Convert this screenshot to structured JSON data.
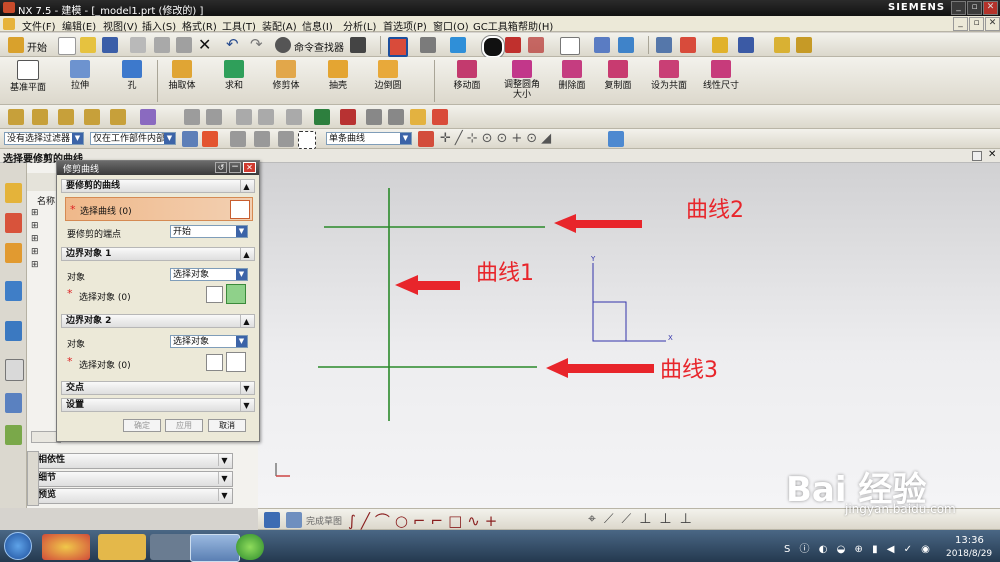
{
  "window": {
    "title": "NX 7.5 - 建模 - [_model1.prt  (修改的) ]",
    "brand": "SIEMENS"
  },
  "menus": [
    "文件(F)",
    "编辑(E)",
    "视图(V)",
    "插入(S)",
    "格式(R)",
    "工具(T)",
    "装配(A)",
    "信息(I)",
    "分析(L)",
    "首选项(P)",
    "窗口(O)",
    "GC工具箱",
    "帮助(H)"
  ],
  "toolbar1": {
    "start_label": "开始",
    "command_finder": "命令查找器"
  },
  "feature_buttons": [
    {
      "label": "基准平面"
    },
    {
      "label": "拉伸"
    },
    {
      "label": "孔"
    },
    {
      "label": "抽取体"
    },
    {
      "label": "求和"
    },
    {
      "label": "修剪体"
    },
    {
      "label": "抽壳"
    },
    {
      "label": "边倒圆"
    },
    {
      "label": "移动面"
    },
    {
      "label": "调整圆角大小"
    },
    {
      "label": "删除面"
    },
    {
      "label": "复制面"
    },
    {
      "label": "设为共面"
    },
    {
      "label": "线性尺寸"
    }
  ],
  "selection_bar": {
    "filter": "没有选择过滤器",
    "scope": "仅在工作部件内部",
    "curve_rule": "单条曲线"
  },
  "cue_line": "选择要修剪的曲线",
  "dialog": {
    "title": "修剪曲线",
    "section_curve": "要修剪的曲线",
    "select_curve": "选择曲线 (0)",
    "end_label": "要修剪的端点",
    "end_value": "开始",
    "boundary1": "边界对象 1",
    "boundary2": "边界对象 2",
    "object_label": "对象",
    "object_value": "选择对象",
    "select_object": "选择对象 (0)",
    "intersection": "交点",
    "settings": "设置",
    "ok": "确定",
    "apply": "应用",
    "cancel": "取消"
  },
  "navigator": {
    "col_name": "名称",
    "sections": [
      "相依性",
      "细节",
      "预览"
    ]
  },
  "annotations": {
    "curve1": "曲线1",
    "curve2": "曲线2",
    "curve3": "曲线3",
    "arrow_color": "#e8252b",
    "curve_color": "#2a8a2a"
  },
  "bottom_toolbar": {
    "finish_sketch": "完成草图"
  },
  "taskbar": {
    "time": "13:36",
    "date": "2018/8/29"
  },
  "watermark": {
    "text": "Bai 经验",
    "sub": "jingyan.baidu.com"
  }
}
